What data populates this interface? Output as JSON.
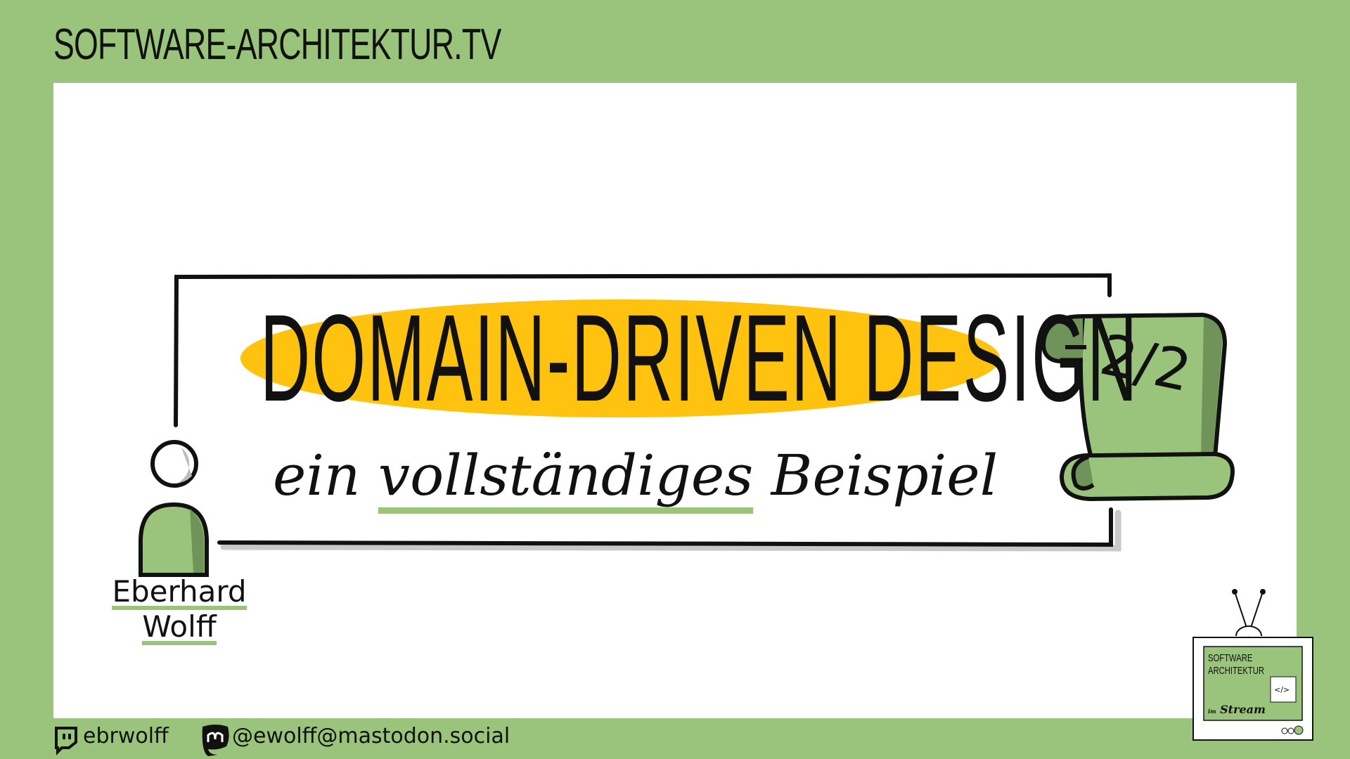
{
  "header": {
    "site_title": "SOFTWARE-ARCHITEKTUR.TV"
  },
  "slide": {
    "title": "DOMAIN-DRIVEN DESIGN",
    "subtitle_before": "ein ",
    "subtitle_highlight": "vollständiges",
    "subtitle_after": " Beispiel",
    "part": "2/2",
    "speaker_first": "Eberhard",
    "speaker_last": "Wolff"
  },
  "footer": {
    "twitch_handle": "ebrwolff",
    "mastodon_handle": "@ewolff@mastodon.social"
  },
  "logo": {
    "line1": "SOFTWARE",
    "line2": "ARCHITEKTUR",
    "line3_small": "im",
    "line3": "Stream",
    "code": "</>"
  },
  "colors": {
    "background": "#9ac47b",
    "highlight": "#ffc20e",
    "dark_green": "#6f9358",
    "ink": "#111111"
  },
  "icons": [
    "twitch-icon",
    "mastodon-icon",
    "person-icon",
    "scroll-icon",
    "tv-logo-icon"
  ]
}
